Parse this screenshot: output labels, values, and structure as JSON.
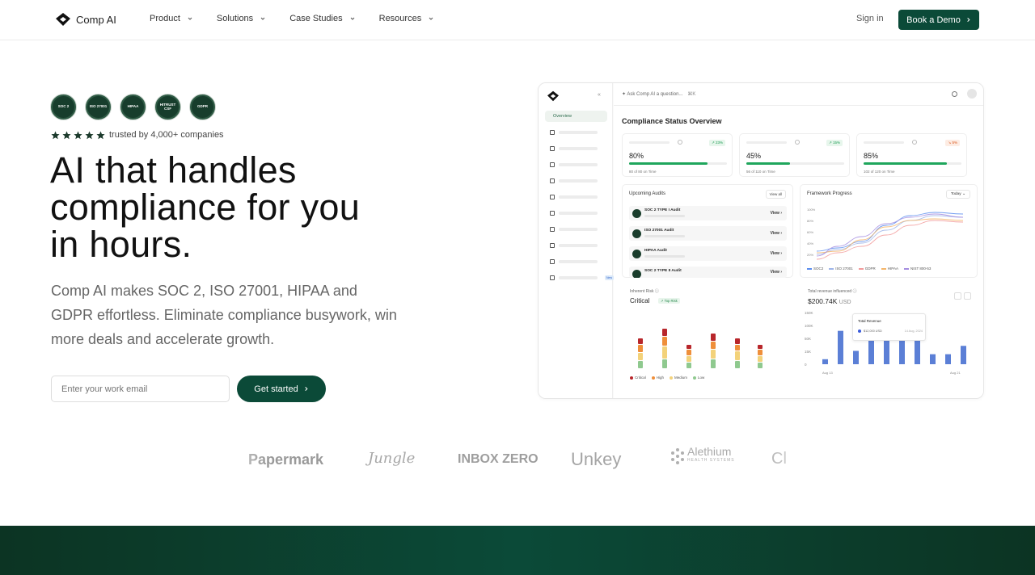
{
  "nav": {
    "brand": "Comp AI",
    "menu": [
      "Product",
      "Solutions",
      "Case Studies",
      "Resources"
    ],
    "signin": "Sign in",
    "cta": "Book a Demo"
  },
  "hero": {
    "badges": [
      "SOC 2",
      "ISO 27001",
      "HIPAA",
      "HITRUST CSF",
      "GDPR"
    ],
    "trust": "trusted by 4,000+ companies",
    "rating_stars": 5,
    "headline": "AI that handles compliance for you in hours.",
    "subhead": "Comp AI makes SOC 2, ISO 27001, HIPAA and GDPR effortless. Eliminate compliance busywork, win more deals and accelerate growth.",
    "email_placeholder": "Enter your work email",
    "cta": "Get started"
  },
  "dashboard": {
    "sidebar_active": "Overview",
    "sidebar_badge": "New",
    "ask": "Ask Comp AI a question...",
    "ask_shortcut": "⌘K",
    "title": "Compliance Status Overview",
    "stats": [
      {
        "pct": "80%",
        "sub": "80 of 80 on Time",
        "delta": "↗ 23%",
        "fill": 0.8,
        "trend": "up"
      },
      {
        "pct": "45%",
        "sub": "56 of 110 on Time",
        "delta": "↗ 15%",
        "fill": 0.45,
        "trend": "up"
      },
      {
        "pct": "85%",
        "sub": "102 of 120 on Time",
        "delta": "↘ 5%",
        "fill": 0.85,
        "trend": "down"
      }
    ],
    "audits": {
      "title": "Upcoming Audits",
      "view_all": "View all",
      "items": [
        "SOC 2 TYPE I Audit",
        "ISO 27001 Audit",
        "HIPAA Audit",
        "SOC 2 TYPE II Audit"
      ],
      "view_label": "View"
    },
    "framework": {
      "title": "Framework Progress",
      "range": "Today",
      "yticks": [
        "100%",
        "80%",
        "60%",
        "40%",
        "20%"
      ],
      "series": [
        "SOC2",
        "ISO 27001",
        "GDPR",
        "HIPAA",
        "NIST 800-53"
      ],
      "colors": [
        "#5b8def",
        "#9db4e8",
        "#f29a9a",
        "#f4b56a",
        "#a58de0"
      ]
    },
    "risk": {
      "title": "Inherent Risk",
      "level": "Critical",
      "tag": "Top Risk",
      "legend": [
        "Critical",
        "High",
        "Medium",
        "Low"
      ],
      "colors": [
        "#b8262b",
        "#ef8f3a",
        "#f3d27a",
        "#8fc98f"
      ]
    },
    "revenue": {
      "title": "Total revenue influenced",
      "value": "$200.74K",
      "unit": "USD",
      "yticks": [
        "150K",
        "100K",
        "50K",
        "15K",
        "0"
      ],
      "x_start": "Aug 13",
      "x_end": "Aug 21",
      "bars": [
        15,
        100,
        40,
        95,
        95,
        95,
        80,
        30,
        30,
        55
      ],
      "tooltip_title": "Total Revenue",
      "tooltip_value": "$12,000 USD",
      "tooltip_date": "14 Aug, 2024"
    }
  },
  "logos": [
    "Papermark",
    "Jungle",
    "INBOX ZERO",
    "Unkey",
    "Alethium",
    "HEALTH SYSTEMS",
    "Cl"
  ]
}
